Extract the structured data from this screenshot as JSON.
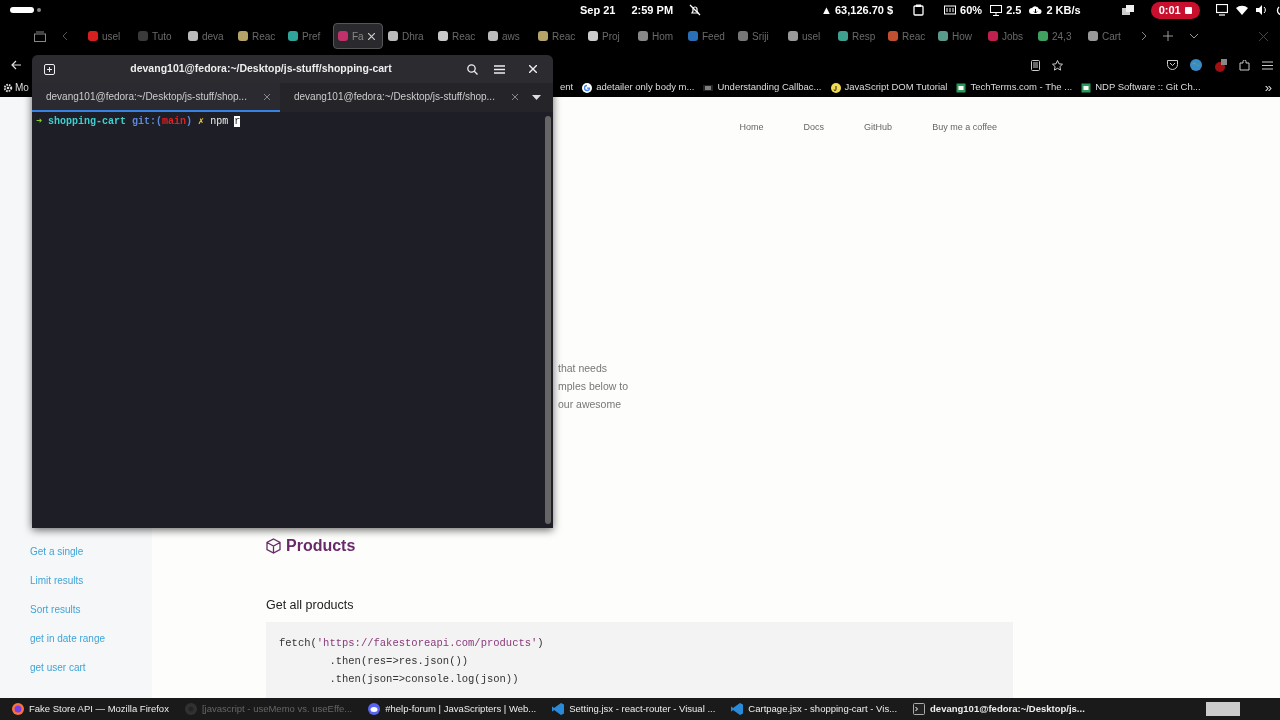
{
  "top_bar": {
    "date": "Sep 21",
    "time": "2:59 PM",
    "price": "▲ 63,126.70 $",
    "battery": "60%",
    "load": "2.5",
    "network": "2 KB/s",
    "recording": "0:01"
  },
  "browser": {
    "tabs": [
      {
        "label": "usel",
        "selected": false,
        "color": "#d62020"
      },
      {
        "label": "Tuto",
        "selected": false,
        "color": "#3a3a3a"
      },
      {
        "label": "deva",
        "selected": false,
        "color": "#bbbbbb"
      },
      {
        "label": "Reac",
        "selected": false,
        "color": "#b5a36a"
      },
      {
        "label": "Pref",
        "selected": false,
        "color": "#2fa59a"
      },
      {
        "label": "Fa",
        "selected": true,
        "color": "#c0306a"
      },
      {
        "label": "Dhra",
        "selected": false,
        "color": "#bbbbbb"
      },
      {
        "label": "Reac",
        "selected": false,
        "color": "#c8c8c8"
      },
      {
        "label": "aws",
        "selected": false,
        "color": "#bbbbbb"
      },
      {
        "label": "Reac",
        "selected": false,
        "color": "#b5a36a"
      },
      {
        "label": "Proj",
        "selected": false,
        "color": "#cccccc"
      },
      {
        "label": "Hom",
        "selected": false,
        "color": "#888888"
      },
      {
        "label": "Feed",
        "selected": false,
        "color": "#2a6eb5"
      },
      {
        "label": "Sriji",
        "selected": false,
        "color": "#777777"
      },
      {
        "label": "usel",
        "selected": false,
        "color": "#999999"
      },
      {
        "label": "Resp",
        "selected": false,
        "color": "#3fa08f"
      },
      {
        "label": "Reac",
        "selected": false,
        "color": "#c05030"
      },
      {
        "label": "How",
        "selected": false,
        "color": "#5a9a8a"
      },
      {
        "label": "Jobs",
        "selected": false,
        "color": "#c02050"
      },
      {
        "label": "24,3",
        "selected": false,
        "color": "#40a060"
      },
      {
        "label": "Cart",
        "selected": false,
        "color": "#999999"
      }
    ],
    "bookmarks": [
      {
        "label": "Mo",
        "kind": "gear"
      },
      {
        "label": "ent",
        "kind": "plain"
      },
      {
        "label": "adetailer only body m...",
        "kind": "google"
      },
      {
        "label": "Understanding Callbac...",
        "kind": "dev"
      },
      {
        "label": "JavaScript DOM Tutorial",
        "kind": "js"
      },
      {
        "label": "TechTerms.com - The ...",
        "kind": "square"
      },
      {
        "label": "NDP Software :: Git Ch...",
        "kind": "square"
      }
    ],
    "more": "»"
  },
  "page": {
    "nav": [
      "Home",
      "Docs",
      "GitHub",
      "Buy me a coffee"
    ],
    "intro_lines": [
      "that needs",
      "mples below to",
      "our awesome"
    ],
    "sidebar": [
      "Get a single",
      "Limit results",
      "Sort results",
      "get in date range",
      "get user cart"
    ],
    "section_title": "Products",
    "subheading": "Get all products",
    "code": [
      [
        {
          "text": "fetch(",
          "kind": "plain"
        },
        {
          "text": "'https://fakestoreapi.com/products'",
          "kind": "string"
        },
        {
          "text": ")",
          "kind": "plain"
        }
      ],
      [
        {
          "text": "        .then(res=>res.json())",
          "kind": "plain"
        }
      ],
      [
        {
          "text": "        .then(json=>console.log(json))",
          "kind": "plain"
        }
      ]
    ]
  },
  "terminal": {
    "title": "devang101@fedora:~/Desktop/js-stuff/shopping-cart",
    "tabs": [
      {
        "label": "devang101@fedora:~/Desktop/js-stuff/shop...",
        "selected": true
      },
      {
        "label": "devang101@fedora:~/Desktop/js-stuff/shop...",
        "selected": false
      }
    ],
    "prompt": {
      "arrow": "➜",
      "dir": "shopping-cart",
      "git": "git:(",
      "branch": "main",
      "git_end": ")",
      "dirty": "✗",
      "command": "npm r"
    }
  },
  "taskbar": [
    {
      "label": "Fake Store API — Mozilla Firefox",
      "kind": "firefox",
      "dimmed": false
    },
    {
      "label": "[javascript - useMemo vs. useEffe...",
      "kind": "chrome",
      "dimmed": true
    },
    {
      "label": "#help-forum | JavaScripters | Web...",
      "kind": "discord",
      "dimmed": false
    },
    {
      "label": "Setting.jsx - react-router - Visual ...",
      "kind": "vscode",
      "dimmed": false
    },
    {
      "label": "Cartpage.jsx - shopping-cart - Vis...",
      "kind": "vscode",
      "dimmed": false
    },
    {
      "label": "devang101@fedora:~/Desktop/js...",
      "kind": "terminal",
      "dimmed": false
    }
  ]
}
